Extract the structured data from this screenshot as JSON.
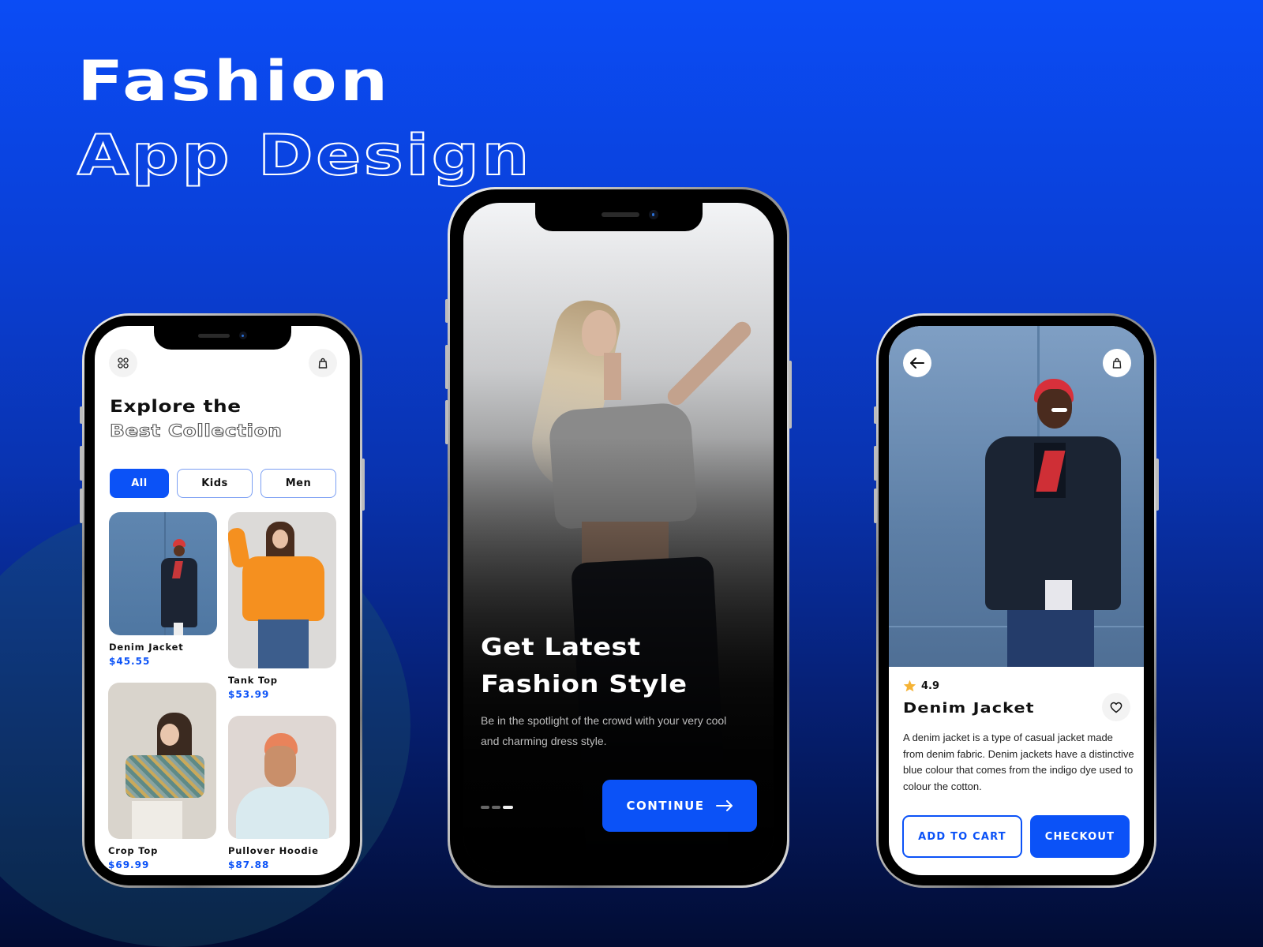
{
  "header": {
    "title": "Fashion",
    "subtitle": "App Design"
  },
  "colors": {
    "accent": "#0b52f7",
    "background_top": "#0b4cf5",
    "background_bottom": "#020c33",
    "star": "#f5b335"
  },
  "explore_screen": {
    "menu_icon": "grid-icon",
    "bag_icon": "shopping-bag-icon",
    "title_line1": "Explore the",
    "title_line2": "Best Collection",
    "tabs": [
      {
        "label": "All",
        "active": true
      },
      {
        "label": "Kids",
        "active": false
      },
      {
        "label": "Men",
        "active": false
      }
    ],
    "products": [
      {
        "name": "Denim Jacket",
        "price": "$45.55"
      },
      {
        "name": "Tank Top",
        "price": "$53.99"
      },
      {
        "name": "Crop Top",
        "price": "$69.99"
      },
      {
        "name": "Pullover Hoodie",
        "price": "$87.88"
      }
    ]
  },
  "onboarding_screen": {
    "title_line1": "Get Latest",
    "title_line2": "Fashion Style",
    "description": "Be in the spotlight of the crowd with your very cool and charming dress style.",
    "page_indicator": {
      "total": 3,
      "current": 3
    },
    "continue_label": "CONTINUE",
    "continue_icon": "arrow-right-icon"
  },
  "detail_screen": {
    "back_icon": "arrow-left-icon",
    "bag_icon": "shopping-bag-icon",
    "rating": "4.9",
    "title": "Denim Jacket",
    "favorite_icon": "heart-icon",
    "description": "A denim jacket is a type of casual jacket made from denim fabric. Denim jackets have a distinctive blue colour that comes from the indigo dye used to colour the cotton.",
    "add_to_cart_label": "ADD TO CART",
    "checkout_label": "CHECKOUT"
  }
}
